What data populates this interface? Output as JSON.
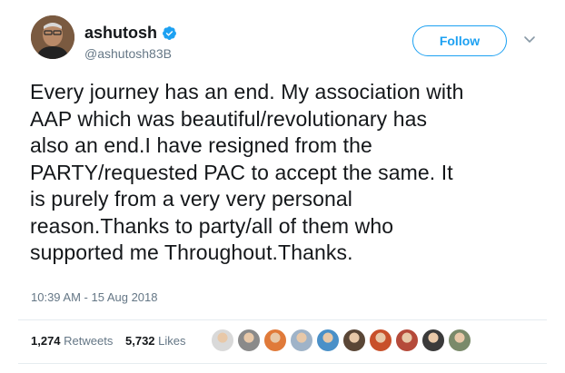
{
  "user": {
    "name": "ashutosh",
    "handle": "@ashutosh83B",
    "verified": true,
    "avatar_icon": "user-avatar-photo"
  },
  "actions": {
    "follow_label": "Follow",
    "menu_icon": "chevron-down-icon"
  },
  "tweet": {
    "lines": [
      "Every journey has an end. My association with",
      "AAP which was beautiful/revolutionary has",
      "also an end.I have resigned from the",
      "PARTY/requested PAC to accept the same. It",
      "is purely from a very very personal",
      "reason.Thanks to party/all of them who",
      "supported me Throughout.Thanks."
    ],
    "timestamp": "10:39 AM - 15 Aug 2018"
  },
  "stats": {
    "retweets_count": "1,274",
    "retweets_label": "Retweets",
    "likes_count": "5,732",
    "likes_label": "Likes"
  },
  "colors": {
    "brand": "#1da1f2",
    "muted": "#657786",
    "text": "#14171a",
    "divider": "#e6ecf0"
  },
  "likers": [
    {
      "icon": "liker-avatar-1",
      "color": "#d9d9d9"
    },
    {
      "icon": "liker-avatar-2",
      "color": "#8a8a8a"
    },
    {
      "icon": "liker-avatar-3",
      "color": "#e07a3a"
    },
    {
      "icon": "liker-avatar-4",
      "color": "#9fb3c8"
    },
    {
      "icon": "liker-avatar-5",
      "color": "#4a90c8"
    },
    {
      "icon": "liker-avatar-6",
      "color": "#5a4636"
    },
    {
      "icon": "liker-avatar-7",
      "color": "#c8502a"
    },
    {
      "icon": "liker-avatar-8",
      "color": "#b54a3a"
    },
    {
      "icon": "liker-avatar-9",
      "color": "#3a3a3a"
    },
    {
      "icon": "liker-avatar-10",
      "color": "#7a8a6a"
    }
  ]
}
